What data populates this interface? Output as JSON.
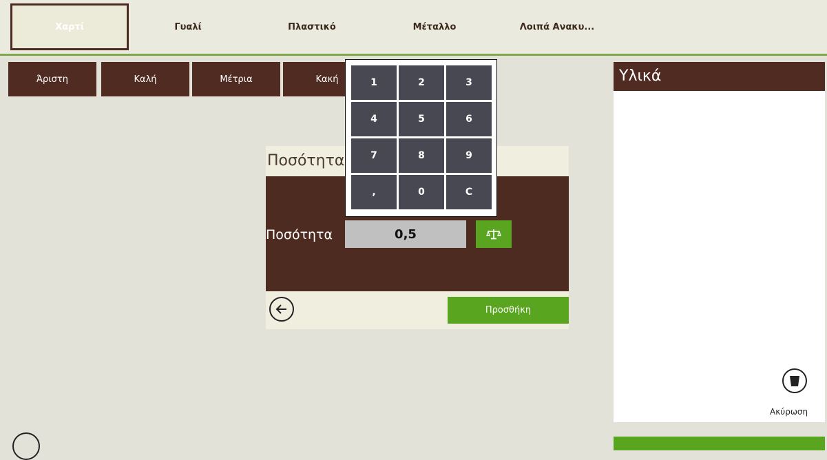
{
  "tabs": [
    {
      "label": "Χαρτί",
      "active": true
    },
    {
      "label": "Γυαλί",
      "active": false
    },
    {
      "label": "Πλαστικό",
      "active": false
    },
    {
      "label": "Μέταλλο",
      "active": false
    },
    {
      "label": "Λοιπά Ανακυ...",
      "active": false
    }
  ],
  "quality": [
    "Άριστη",
    "Καλή",
    "Μέτρια",
    "Κακή"
  ],
  "dialog": {
    "title": "Ποσότητα",
    "quantity_label": "Ποσότητα",
    "quantity_value": "0,5",
    "scale_icon": "scale-icon",
    "add_label": "Προσθήκη",
    "back_icon": "back-arrow-icon"
  },
  "keypad": {
    "keys": [
      "1",
      "2",
      "3",
      "4",
      "5",
      "6",
      "7",
      "8",
      "9",
      ",",
      "0",
      "C"
    ]
  },
  "panel": {
    "title": "Υλικά",
    "cancel_label": "Ακύρωση",
    "cancel_icon": "trash-icon"
  },
  "colors": {
    "brown": "#4f2b21",
    "green": "#5aa520",
    "key_gray": "#474852",
    "background": "#e3e2d9"
  }
}
